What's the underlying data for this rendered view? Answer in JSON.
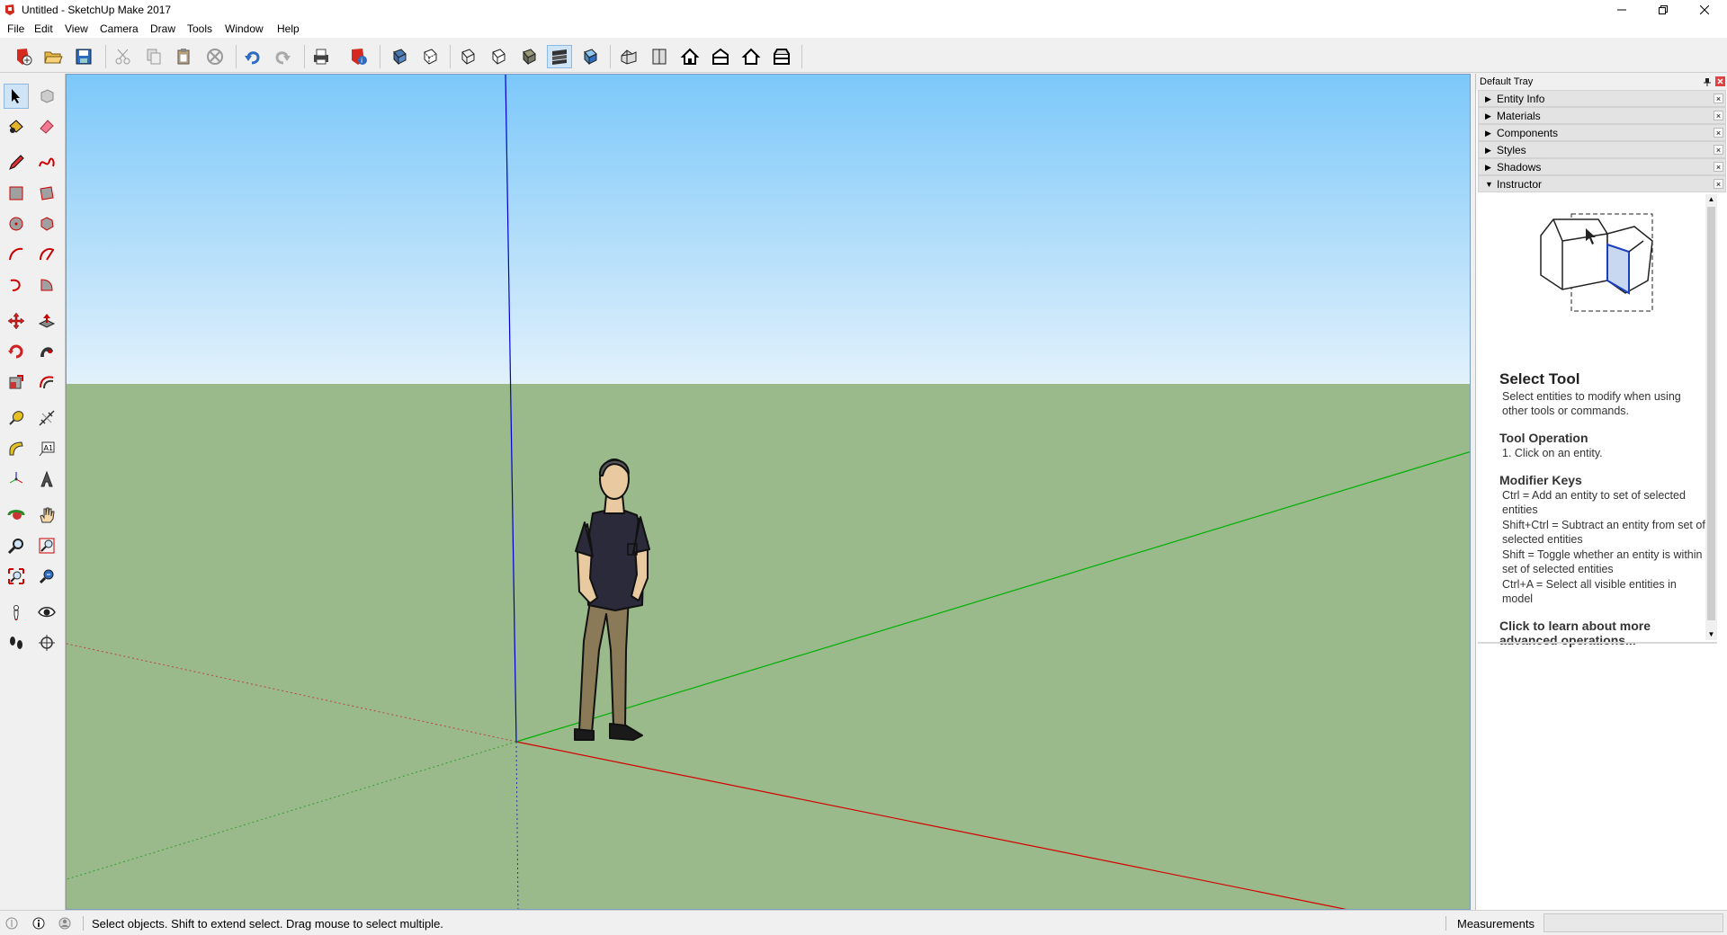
{
  "window": {
    "title": "Untitled - SketchUp Make 2017"
  },
  "menu": [
    "File",
    "Edit",
    "View",
    "Camera",
    "Draw",
    "Tools",
    "Window",
    "Help"
  ],
  "tray": {
    "title": "Default Tray",
    "panels": [
      {
        "label": "Entity Info",
        "expanded": false
      },
      {
        "label": "Materials",
        "expanded": false
      },
      {
        "label": "Components",
        "expanded": false
      },
      {
        "label": "Styles",
        "expanded": false
      },
      {
        "label": "Shadows",
        "expanded": false
      },
      {
        "label": "Instructor",
        "expanded": true
      }
    ]
  },
  "instructor": {
    "title": "Select Tool",
    "description": "Select entities to modify when using other tools or commands.",
    "operation_heading": "Tool Operation",
    "operation_steps": [
      "1. Click on an entity."
    ],
    "modifier_heading": "Modifier Keys",
    "modifiers": [
      "Ctrl = Add an entity to set of selected entities",
      "Shift+Ctrl = Subtract an entity from set of selected entities",
      "Shift = Toggle whether an entity is within set of selected entities",
      "Ctrl+A = Select all visible entities in model"
    ],
    "link": "Click to learn about more advanced operations..."
  },
  "status": {
    "hint": "Select objects. Shift to extend select. Drag mouse to select multiple.",
    "measurements_label": "Measurements",
    "measurements_value": ""
  },
  "colors": {
    "sky_top": "#7cc8fa",
    "sky_bottom": "#e2f1fb",
    "ground": "#9aba8b",
    "axis_red": "#d40000",
    "axis_green": "#00b000",
    "axis_blue": "#0000d0"
  }
}
